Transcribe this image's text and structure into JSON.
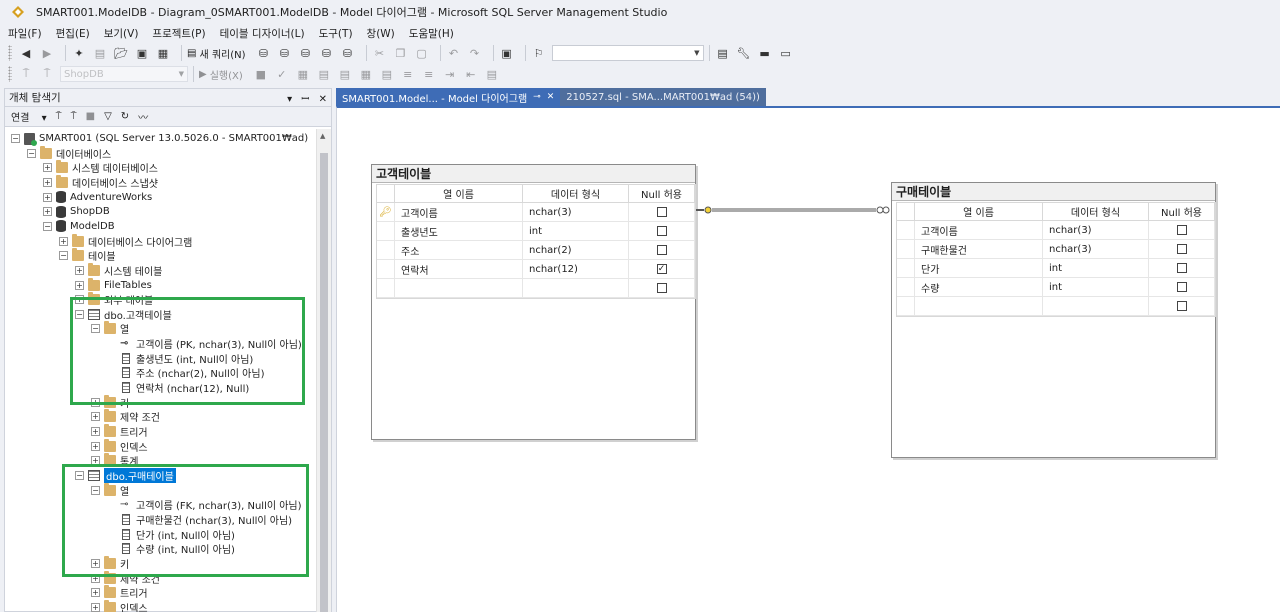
{
  "window": {
    "title": "SMART001.ModelDB - Diagram_0SMART001.ModelDB - Model 다이어그램 - Microsoft SQL Server Management Studio"
  },
  "menu": [
    "파일(F)",
    "편집(E)",
    "보기(V)",
    "프로젝트(P)",
    "테이블 디자이너(L)",
    "도구(T)",
    "창(W)",
    "도움말(H)"
  ],
  "toolbar": {
    "new_query": "새 쿼리(N)",
    "database_combo": "ShopDB",
    "execute": "실행(X)"
  },
  "explorer": {
    "title": "개체 탐색기",
    "connect": "연결",
    "header_controls": [
      "▾",
      "ꟷ",
      "✕"
    ]
  },
  "tree": [
    {
      "label": "SMART001 (SQL Server 13.0.5026.0 - SMART001₩ad)",
      "icon": "server-icon",
      "level": 0,
      "exp": "⊟"
    },
    {
      "label": "데이터베이스",
      "icon": "folder-icon",
      "level": 1,
      "exp": "⊟"
    },
    {
      "label": "시스템 데이터베이스",
      "icon": "folder-icon",
      "level": 2,
      "exp": "⊞"
    },
    {
      "label": "데이터베이스 스냅샷",
      "icon": "folder-icon",
      "level": 2,
      "exp": "⊞"
    },
    {
      "label": "AdventureWorks",
      "icon": "database-icon",
      "level": 2,
      "exp": "⊞"
    },
    {
      "label": "ShopDB",
      "icon": "database-icon",
      "level": 2,
      "exp": "⊞"
    },
    {
      "label": "ModelDB",
      "icon": "database-icon",
      "level": 2,
      "exp": "⊟"
    },
    {
      "label": "데이터베이스 다이어그램",
      "icon": "folder-icon",
      "level": 3,
      "exp": "⊞"
    },
    {
      "label": "테이블",
      "icon": "folder-icon",
      "level": 3,
      "exp": "⊟"
    },
    {
      "label": "시스템 테이블",
      "icon": "folder-icon",
      "level": 4,
      "exp": "⊞"
    },
    {
      "label": "FileTables",
      "icon": "folder-icon",
      "level": 4,
      "exp": "⊞"
    },
    {
      "label": "외부 테이블",
      "icon": "folder-icon",
      "level": 4,
      "exp": "⊞"
    },
    {
      "label": "dbo.고객테이블",
      "icon": "table-icon",
      "level": 4,
      "exp": "⊟"
    },
    {
      "label": "열",
      "icon": "folder-icon",
      "level": 5,
      "exp": "⊟"
    },
    {
      "label": "고객이름 (PK, nchar(3), Null이 아님)",
      "icon": "primary-key-icon",
      "level": 6,
      "exp": ""
    },
    {
      "label": "출생년도 (int, Null이 아님)",
      "icon": "column-icon",
      "level": 6,
      "exp": ""
    },
    {
      "label": "주소 (nchar(2), Null이 아님)",
      "icon": "column-icon",
      "level": 6,
      "exp": ""
    },
    {
      "label": "연락처 (nchar(12), Null)",
      "icon": "column-icon",
      "level": 6,
      "exp": ""
    },
    {
      "label": "키",
      "icon": "folder-icon",
      "level": 5,
      "exp": "⊞"
    },
    {
      "label": "제약 조건",
      "icon": "folder-icon",
      "level": 5,
      "exp": "⊞"
    },
    {
      "label": "트리거",
      "icon": "folder-icon",
      "level": 5,
      "exp": "⊞"
    },
    {
      "label": "인덱스",
      "icon": "folder-icon",
      "level": 5,
      "exp": "⊞"
    },
    {
      "label": "통계",
      "icon": "folder-icon",
      "level": 5,
      "exp": "⊞"
    },
    {
      "label": "dbo.구매테이블",
      "icon": "table-icon",
      "level": 4,
      "exp": "⊟",
      "selected": true
    },
    {
      "label": "열",
      "icon": "folder-icon",
      "level": 5,
      "exp": "⊟"
    },
    {
      "label": "고객이름 (FK, nchar(3), Null이 아님)",
      "icon": "foreign-key-icon",
      "level": 6,
      "exp": ""
    },
    {
      "label": "구매한물건 (nchar(3), Null이 아님)",
      "icon": "column-icon",
      "level": 6,
      "exp": ""
    },
    {
      "label": "단가 (int, Null이 아님)",
      "icon": "column-icon",
      "level": 6,
      "exp": ""
    },
    {
      "label": "수량 (int, Null이 아님)",
      "icon": "column-icon",
      "level": 6,
      "exp": ""
    },
    {
      "label": "키",
      "icon": "folder-icon",
      "level": 5,
      "exp": "⊞"
    },
    {
      "label": "제약 조건",
      "icon": "folder-icon",
      "level": 5,
      "exp": "⊞"
    },
    {
      "label": "트리거",
      "icon": "folder-icon",
      "level": 5,
      "exp": "⊞"
    },
    {
      "label": "인덱스",
      "icon": "folder-icon",
      "level": 5,
      "exp": "⊞"
    }
  ],
  "tabs": [
    {
      "label": "SMART001.Model... - Model 다이어그램",
      "pin": "⊸",
      "close": "✕",
      "active": true
    },
    {
      "label": "210527.sql - SMA...MART001₩ad (54))",
      "active": false
    }
  ],
  "grid_headers": {
    "name": "열 이름",
    "type": "데이터 형식",
    "null": "Null 허용"
  },
  "tables": [
    {
      "title": "고객테이블",
      "rows": [
        {
          "name": "고객이름",
          "type": "nchar(3)",
          "nullable": false,
          "pk": true
        },
        {
          "name": "출생년도",
          "type": "int",
          "nullable": false
        },
        {
          "name": "주소",
          "type": "nchar(2)",
          "nullable": false
        },
        {
          "name": "연락처",
          "type": "nchar(12)",
          "nullable": true
        },
        {
          "name": "",
          "type": "",
          "nullable": false
        }
      ]
    },
    {
      "title": "구매테이블",
      "rows": [
        {
          "name": "고객이름",
          "type": "nchar(3)",
          "nullable": false
        },
        {
          "name": "구매한물건",
          "type": "nchar(3)",
          "nullable": false
        },
        {
          "name": "단가",
          "type": "int",
          "nullable": false
        },
        {
          "name": "수량",
          "type": "int",
          "nullable": false
        },
        {
          "name": "",
          "type": "",
          "nullable": false
        }
      ]
    }
  ],
  "colors": {
    "highlight": "#2ea84c",
    "selection": "#0078d7",
    "tab": "#3e6cb6"
  }
}
